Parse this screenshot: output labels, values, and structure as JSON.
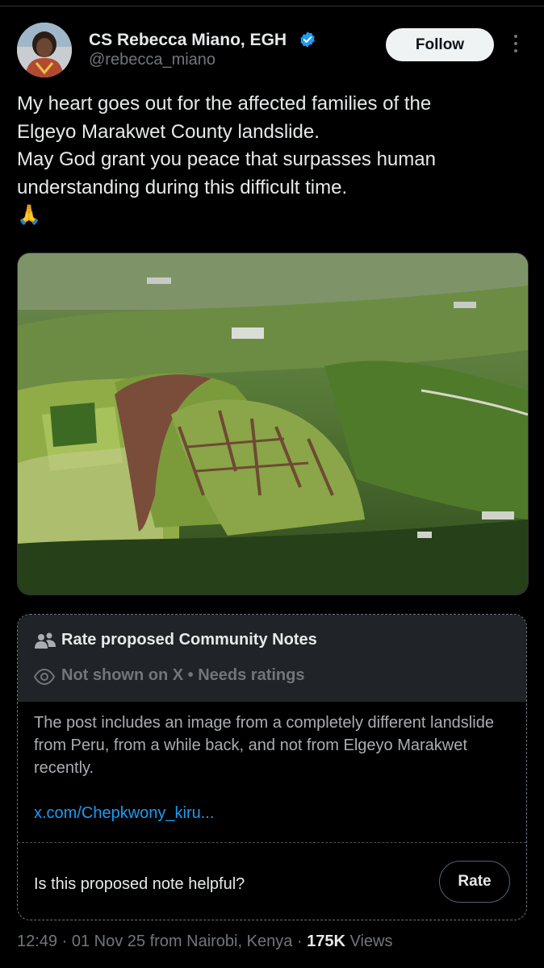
{
  "author": {
    "name": "CS Rebecca Miano, EGH",
    "handle": "@rebecca_miano",
    "verified_color": "#1d9bf0"
  },
  "follow_label": "Follow",
  "tweet": {
    "lines": [
      "My heart goes out for the affected families of the",
      "Elgeyo Marakwet County landslide.",
      "May God grant you peace that surpasses human",
      "understanding during this difficult time.",
      "🙏"
    ]
  },
  "community_note": {
    "title": "Rate proposed Community Notes",
    "status": "Not shown on X • Needs ratings",
    "body": "The post includes an image from a completely different landslide from Peru, from a while back, and not from Elgeyo Marakwet recently.",
    "link": "x.com/Chepkwony_kiru...",
    "question": "Is this proposed note helpful?",
    "rate_label": "Rate"
  },
  "meta": {
    "time": "12:49",
    "date": "01 Nov 25",
    "location": "from Nairobi, Kenya",
    "views_count": "175K",
    "views_label": "Views"
  },
  "colors": {
    "background": "#000000",
    "accent": "#1d9bf0",
    "note_header_bg": "#202327"
  }
}
